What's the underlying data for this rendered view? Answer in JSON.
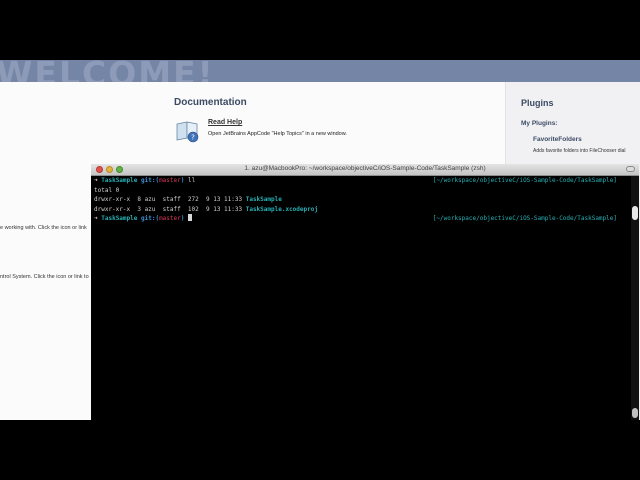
{
  "app": {
    "banner_text": "WELCOME!",
    "documentation": {
      "heading": "Documentation",
      "link": "Read Help",
      "description": "Open JetBrains AppCode \"Help Topics\" in a new window."
    },
    "plugins": {
      "heading": "Plugins",
      "my_plugins": "My Plugins:",
      "item_name": "FavoriteFolders",
      "item_desc": "Adds favorite folders into FileChooser dial"
    },
    "left_snippets": [
      "e working with. Click the icon or link",
      "ntrol System. Click the icon or link to"
    ]
  },
  "terminal": {
    "title": "1. azu@MacbookPro: ~/workspace/objectiveC/iOS-Sample-Code/TaskSample (zsh)",
    "prompt_arrow": "➜",
    "prompt_dir": "TaskSample",
    "git_label": "git:(",
    "branch": "master",
    "git_close": ")",
    "command": "ll",
    "right_prompt": "[~/workspace/objectiveC/iOS-Sample-Code/TaskSample]",
    "total_line": "total 0",
    "entries": [
      {
        "meta": "drwxr-xr-x  8 azu  staff  272  9 13 11:33 ",
        "name": "TaskSample"
      },
      {
        "meta": "drwxr-xr-x  3 azu  staff  102  9 13 11:33 ",
        "name": "TaskSample.xcodeproj"
      }
    ]
  },
  "colors": {
    "banner": "#7585a5",
    "prompt_dir": "#27b0b5",
    "git_label": "#3c8fd6",
    "branch": "#d8375a",
    "close": "#e0524b",
    "minimize": "#e3b341",
    "zoom": "#62b446"
  }
}
